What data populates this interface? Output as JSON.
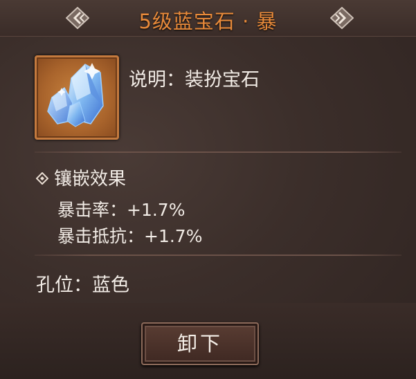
{
  "header": {
    "title": "5级蓝宝石 · 暴",
    "prev_icon": "chevron-left-icon",
    "next_icon": "chevron-right-icon"
  },
  "item": {
    "icon": "blue-gem-icon",
    "description": "说明：装扮宝石"
  },
  "inlay": {
    "heading": "镶嵌效果",
    "stats": [
      "暴击率：+1.7%",
      "暴击抵抗：+1.7%"
    ]
  },
  "slot": {
    "text": "孔位：蓝色"
  },
  "actions": {
    "unequip_label": "卸下"
  },
  "colors": {
    "title": "#e88a3a",
    "frame": "#c47a3e",
    "text": "#f2ece6"
  }
}
